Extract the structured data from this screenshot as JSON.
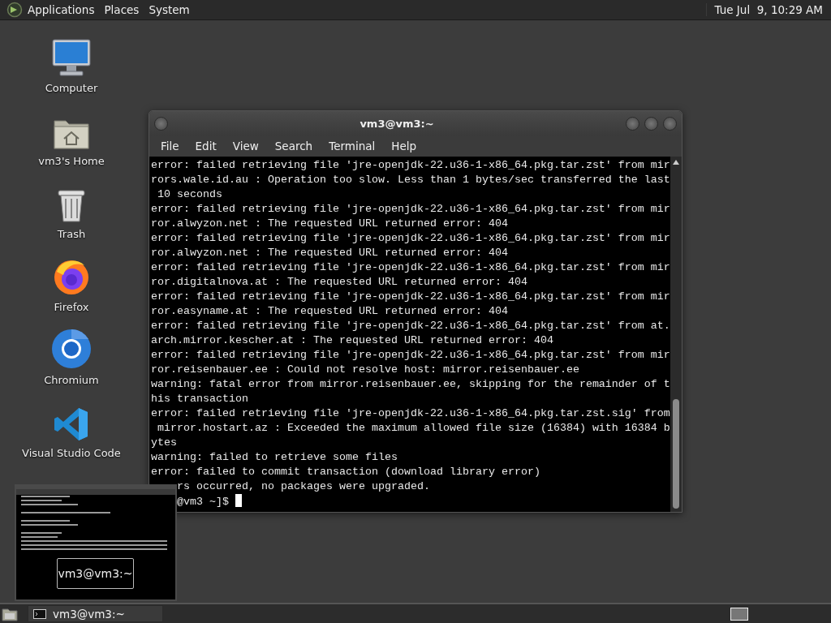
{
  "top_panel": {
    "menus": [
      "Applications",
      "Places",
      "System"
    ],
    "clock": "Tue Jul  9, 10:29 AM"
  },
  "desktop_icons": [
    {
      "label": "Computer",
      "kind": "computer"
    },
    {
      "label": "vm3's Home",
      "kind": "home"
    },
    {
      "label": "Trash",
      "kind": "trash"
    },
    {
      "label": "Firefox",
      "kind": "firefox"
    },
    {
      "label": "Chromium",
      "kind": "chromium"
    },
    {
      "label": "Visual Studio Code",
      "kind": "vscode"
    }
  ],
  "terminal_window": {
    "title": "vm3@vm3:~",
    "menu": [
      "File",
      "Edit",
      "View",
      "Search",
      "Terminal",
      "Help"
    ],
    "lines": [
      {
        "kind": "full",
        "text": "error: failed retrieving file 'jre-openjdk-22.u36-1-x86_64.pkg.tar.zst' from mir"
      },
      {
        "kind": "full",
        "text": "rors.wale.id.au : Operation too slow. Less than 1 bytes/sec transferred the last"
      },
      {
        "kind": "full",
        "text": " 10 seconds"
      },
      {
        "kind": "full",
        "text": "error: failed retrieving file 'jre-openjdk-22.u36-1-x86_64.pkg.tar.zst' from mir"
      },
      {
        "kind": "full",
        "text": "ror.alwyzon.net : The requested URL returned error: 404"
      },
      {
        "kind": "full",
        "text": "error: failed retrieving file 'jre-openjdk-22.u36-1-x86_64.pkg.tar.zst' from mir"
      },
      {
        "kind": "full",
        "text": "ror.alwyzon.net : The requested URL returned error: 404"
      },
      {
        "kind": "full",
        "text": "error: failed retrieving file 'jre-openjdk-22.u36-1-x86_64.pkg.tar.zst' from mir"
      },
      {
        "kind": "full",
        "text": "ror.digitalnova.at : The requested URL returned error: 404"
      },
      {
        "kind": "full",
        "text": "error: failed retrieving file 'jre-openjdk-22.u36-1-x86_64.pkg.tar.zst' from mir"
      },
      {
        "kind": "full",
        "text": "ror.easyname.at : The requested URL returned error: 404"
      },
      {
        "kind": "full",
        "text": "error: failed retrieving file 'jre-openjdk-22.u36-1-x86_64.pkg.tar.zst' from at."
      },
      {
        "kind": "full",
        "text": "arch.mirror.kescher.at : The requested URL returned error: 404"
      },
      {
        "kind": "full",
        "text": "error: failed retrieving file 'jre-openjdk-22.u36-1-x86_64.pkg.tar.zst' from mir"
      },
      {
        "kind": "full",
        "text": "ror.reisenbauer.ee : Could not resolve host: mirror.reisenbauer.ee"
      },
      {
        "kind": "full",
        "text": "warning: fatal error from mirror.reisenbauer.ee, skipping for the remainder of t"
      },
      {
        "kind": "full",
        "text": "his transaction"
      },
      {
        "kind": "full",
        "text": "error: failed retrieving file 'jre-openjdk-22.u36-1-x86_64.pkg.tar.zst.sig' from"
      },
      {
        "kind": "full",
        "text": " mirror.hostart.az : Exceeded the maximum allowed file size (16384) with 16384 b"
      },
      {
        "kind": "full",
        "text": "ytes"
      },
      {
        "kind": "full",
        "text": "warning: failed to retrieve some files"
      },
      {
        "kind": "full",
        "text": "error: failed to commit transaction (download library error)"
      },
      {
        "kind": "partial",
        "text": "rs occurred, no packages were upgraded."
      },
      {
        "kind": "partial",
        "text": "@vm3 ~]$"
      }
    ],
    "cursor_visible": true
  },
  "window_preview": {
    "label": "vm3@vm3:~"
  },
  "bottom_panel": {
    "tasks": [
      {
        "label": "vm3@vm3:~",
        "selected": false
      }
    ]
  }
}
